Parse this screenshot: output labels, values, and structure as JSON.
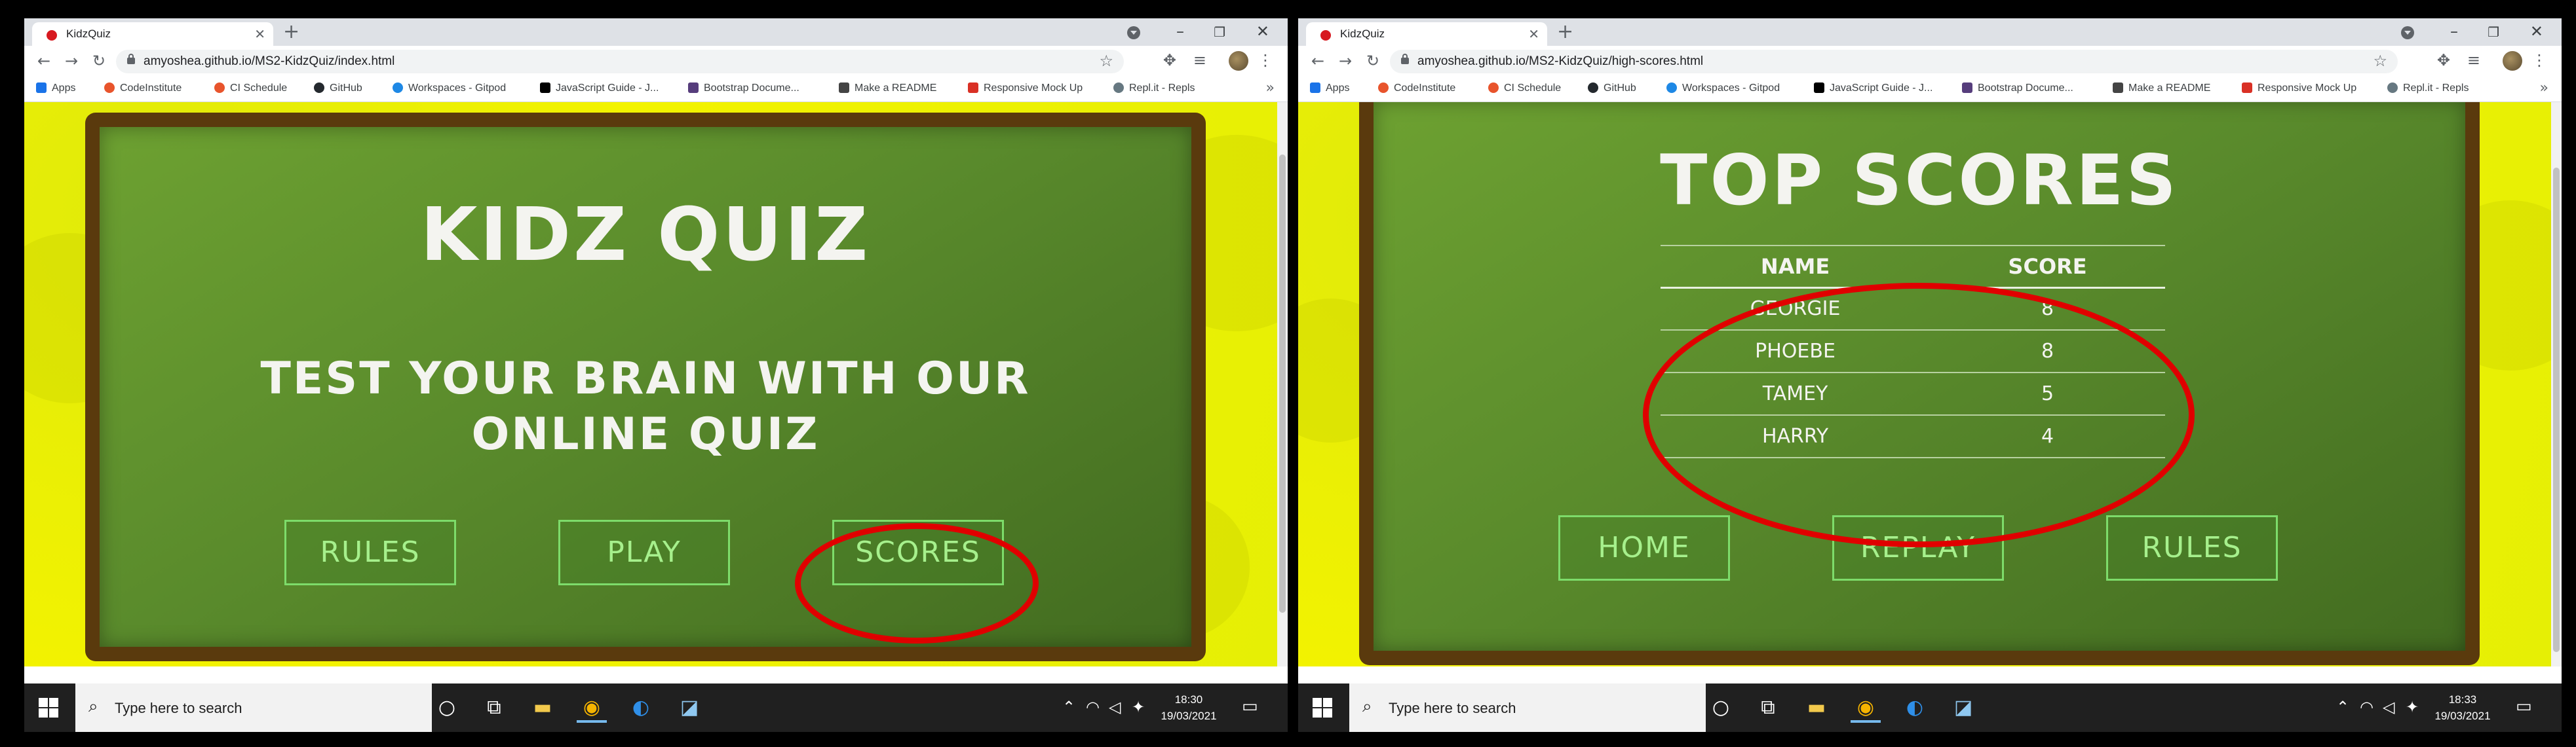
{
  "screens": [
    {
      "tab_title": "KidzQuiz",
      "url": "amyoshea.github.io/MS2-KidzQuiz/index.html",
      "page": {
        "title": "KIDZ QUIZ",
        "subtitle_line1": "TEST YOUR BRAIN WITH OUR",
        "subtitle_line2": "ONLINE QUIZ",
        "buttons": {
          "rules": "RULES",
          "play": "PLAY",
          "scores": "SCORES"
        }
      },
      "clock": {
        "time": "18:30",
        "date": "19/03/2021"
      }
    },
    {
      "tab_title": "KidzQuiz",
      "url": "amyoshea.github.io/MS2-KidzQuiz/high-scores.html",
      "page": {
        "title": "TOP SCORES",
        "table": {
          "headers": [
            "NAME",
            "SCORE"
          ],
          "rows": [
            {
              "name": "GEORGIE",
              "score": "8"
            },
            {
              "name": "PHOEBE",
              "score": "8"
            },
            {
              "name": "TAMEY",
              "score": "5"
            },
            {
              "name": "HARRY",
              "score": "4"
            }
          ]
        },
        "buttons": {
          "home": "HOME",
          "replay": "REPLAY",
          "rules": "RULES"
        }
      },
      "clock": {
        "time": "18:33",
        "date": "19/03/2021"
      }
    }
  ],
  "bookmarks": [
    {
      "label": "Apps",
      "icon": "apps-grid-icon",
      "color": "#1a73e8"
    },
    {
      "label": "CodeInstitute",
      "icon": "codeinstitute-icon",
      "color": "#e8542c"
    },
    {
      "label": "CI Schedule",
      "icon": "ci-schedule-icon",
      "color": "#e8542c"
    },
    {
      "label": "GitHub",
      "icon": "github-icon",
      "color": "#24292e"
    },
    {
      "label": "Workspaces - Gitpod",
      "icon": "gitpod-icon",
      "color": "#1e88e5"
    },
    {
      "label": "JavaScript Guide - J...",
      "icon": "mdn-icon",
      "color": "#000000"
    },
    {
      "label": "Bootstrap Docume...",
      "icon": "bootstrap-icon",
      "color": "#563d7c"
    },
    {
      "label": "Make a README",
      "icon": "document-icon",
      "color": "#444444"
    },
    {
      "label": "Responsive Mock Up",
      "icon": "responsive-icon",
      "color": "#d93025"
    },
    {
      "label": "Repl.it - Repls",
      "icon": "replit-icon",
      "color": "#667881"
    }
  ],
  "taskbar": {
    "search_placeholder": "Type here to search"
  },
  "colors": {
    "chalkboard": "#5a8b2c",
    "frame": "#5a3a0d",
    "background": "#f3f300",
    "button_border": "#7ddc6a",
    "highlight_circle": "#e00000"
  }
}
